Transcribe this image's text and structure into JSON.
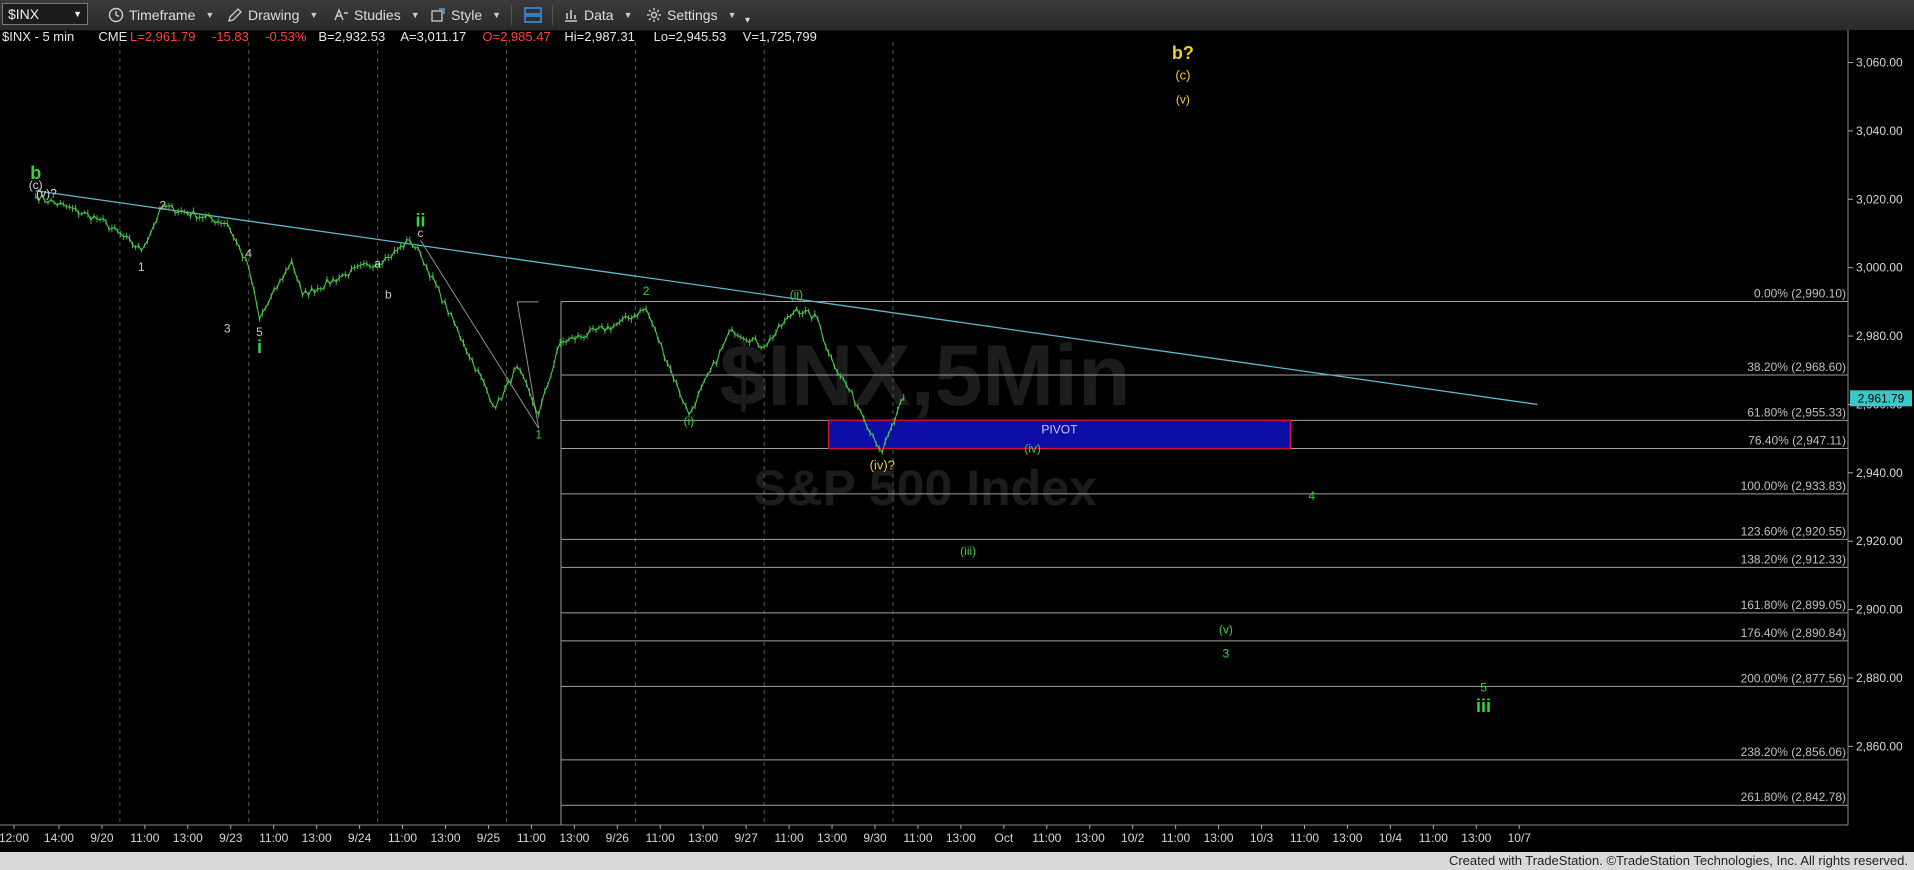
{
  "toolbar": {
    "symbol": "$INX",
    "items": [
      {
        "label": "Timeframe",
        "icon": "clock-icon"
      },
      {
        "label": "Drawing",
        "icon": "pencil-icon"
      },
      {
        "label": "Studies",
        "icon": "studies-icon"
      },
      {
        "label": "Style",
        "icon": "style-icon"
      },
      {
        "label": "",
        "icon": "layout-icon"
      },
      {
        "label": "Data",
        "icon": "bar-chart-icon"
      },
      {
        "label": "Settings",
        "icon": "gear-icon"
      }
    ]
  },
  "quote": [
    {
      "text": "$INX - 5 min",
      "color": "#e8e8e8"
    },
    {
      "text": "CME",
      "color": "#e8e8e8"
    },
    {
      "text": "L=2,961.79",
      "color": "#ff4040"
    },
    {
      "text": "-15.83",
      "color": "#ff4040"
    },
    {
      "text": "-0.53%",
      "color": "#ff4040"
    },
    {
      "text": "B=2,932.53",
      "color": "#e8e8e8"
    },
    {
      "text": "A=3,011.17",
      "color": "#e8e8e8"
    },
    {
      "text": "O=2,985.47",
      "color": "#ff4040"
    },
    {
      "text": "Hi=2,987.31",
      "color": "#e8e8e8"
    },
    {
      "text": "Lo=2,945.53",
      "color": "#e8e8e8"
    },
    {
      "text": "V=1,725,799",
      "color": "#e8e8e8"
    }
  ],
  "watermark": {
    "symbol": "$INX,5Min",
    "name": "S&P 500 Index"
  },
  "footer": {
    "credit": "Created with TradeStation. ©TradeStation Technologies, Inc. All rights reserved."
  },
  "chart_data": {
    "type": "line",
    "series": [
      {
        "x": [
          "9/19 12:00",
          "9/19 15:00",
          "9/20 10:30",
          "9/20 11:30",
          "9/20 14:30",
          "9/20 15:30",
          "9/23 10:00",
          "9/23 11:30",
          "9/23 12:00",
          "9/23 14:00",
          "9/24 10:00",
          "9/24 11:00",
          "9/24 11:30",
          "9/24 13:30",
          "9/24 15:00",
          "9/25 10:00",
          "9/25 11:00",
          "9/25 12:00",
          "9/25 14:30",
          "9/26 10:00",
          "9/26 12:00",
          "9/26 14:00",
          "9/26 15:30",
          "9/27 11:00",
          "9/27 12:00",
          "9/27 12:30",
          "9/27 14:00",
          "9/27 15:00",
          "9/27 16:00"
        ],
        "y": [
          3021,
          3014,
          3005,
          3018,
          3013,
          3000,
          2985,
          3002,
          2992,
          2998,
          3003,
          3008,
          3004,
          2978,
          2959,
          2971,
          2957,
          2978,
          2983,
          2988,
          2957,
          2982,
          2977,
          2988,
          2985,
          2975,
          2958,
          2946,
          2962
        ]
      }
    ],
    "ylim": [
      2837,
      3066
    ],
    "y_ticks": [
      "3,060.00",
      "3,040.00",
      "3,020.00",
      "3,000.00",
      "2,980.00",
      "2,960.00",
      "2,940.00",
      "2,920.00",
      "2,900.00",
      "2,880.00",
      "2,860.00"
    ],
    "y_tick_values": [
      3060,
      3040,
      3020,
      3000,
      2980,
      2960,
      2940,
      2920,
      2900,
      2880,
      2860
    ],
    "x_ticks": [
      "12:00",
      "14:00",
      "9/20",
      "11:00",
      "13:00",
      "9/23",
      "11:00",
      "13:00",
      "9/24",
      "11:00",
      "13:00",
      "9/25",
      "11:00",
      "13:00",
      "9/26",
      "11:00",
      "13:00",
      "9/27",
      "11:00",
      "13:00",
      "9/30",
      "11:00",
      "13:00",
      "Oct",
      "11:00",
      "13:00",
      "10/2",
      "11:00",
      "13:00",
      "10/3",
      "11:00",
      "13:00",
      "10/4",
      "11:00",
      "13:00",
      "10/7"
    ],
    "last_price": {
      "value": 2961.79,
      "label": "2,961.79",
      "color": "#3cc8c8"
    },
    "fib_levels": [
      {
        "label": "0.00% (2,990.10)",
        "value": 2990.1
      },
      {
        "label": "38.20% (2,968.60)",
        "value": 2968.6
      },
      {
        "label": "61.80% (2,955.33)",
        "value": 2955.33
      },
      {
        "label": "76.40% (2,947.11)",
        "value": 2947.11
      },
      {
        "label": "100.00% (2,933.83)",
        "value": 2933.83
      },
      {
        "label": "123.60% (2,920.55)",
        "value": 2920.55
      },
      {
        "label": "138.20% (2,912.33)",
        "value": 2912.33
      },
      {
        "label": "161.80% (2,899.05)",
        "value": 2899.05
      },
      {
        "label": "176.40% (2,890.84)",
        "value": 2890.84
      },
      {
        "label": "200.00% (2,877.56)",
        "value": 2877.56
      },
      {
        "label": "238.20% (2,856.06)",
        "value": 2856.06
      },
      {
        "label": "261.80% (2,842.78)",
        "value": 2842.78
      }
    ],
    "pivot": {
      "label": "PIVOT",
      "from": "9/27 12:30",
      "to": "10/3 10:00",
      "high": 2955.33,
      "low": 2947.11
    },
    "wave_labels": [
      {
        "text": "b",
        "x": "9/19 12:00",
        "y": 3026,
        "color": "#35d435",
        "size": "large"
      },
      {
        "text": "(c)",
        "x": "9/19 12:00",
        "y": 3023,
        "color": "#d8d8d8",
        "size": "small"
      },
      {
        "text": "(v)?",
        "x": "9/19 12:30",
        "y": 3020.5,
        "color": "#d8d8d8",
        "size": "small"
      },
      {
        "text": "1",
        "x": "9/20 10:30",
        "y": 2999,
        "color": "#c8c8c8",
        "size": "small"
      },
      {
        "text": "2",
        "x": "9/20 11:30",
        "y": 3017,
        "color": "#c8c8c8",
        "size": "small"
      },
      {
        "text": "3",
        "x": "9/20 14:30",
        "y": 2981,
        "color": "#c8c8c8",
        "size": "small"
      },
      {
        "text": "4",
        "x": "9/20 15:30",
        "y": 3003,
        "color": "#c8c8c8",
        "size": "small"
      },
      {
        "text": "5",
        "x": "9/23 10:00",
        "y": 2980,
        "color": "#c8c8c8",
        "size": "small"
      },
      {
        "text": "i",
        "x": "9/23 10:00",
        "y": 2975,
        "color": "#35d435",
        "size": "large"
      },
      {
        "text": "a",
        "x": "9/23 15:30",
        "y": 3000,
        "color": "#c8c8c8",
        "size": "small"
      },
      {
        "text": "b",
        "x": "9/24 10:00",
        "y": 2991,
        "color": "#c8c8c8",
        "size": "small"
      },
      {
        "text": "c",
        "x": "9/24 11:30",
        "y": 3009,
        "color": "#c8c8c8",
        "size": "small"
      },
      {
        "text": "ii",
        "x": "9/24 11:30",
        "y": 3012,
        "color": "#35d435",
        "size": "large"
      },
      {
        "text": "1",
        "x": "9/25 11:00",
        "y": 2950,
        "color": "#35d435",
        "size": "small"
      },
      {
        "text": "2",
        "x": "9/26 10:00",
        "y": 2992,
        "color": "#35d435",
        "size": "small"
      },
      {
        "text": "(i)",
        "x": "9/26 12:00",
        "y": 2954,
        "color": "#35d435",
        "size": "small"
      },
      {
        "text": "(ii)",
        "x": "9/27 11:00",
        "y": 2991,
        "color": "#35d435",
        "size": "small"
      },
      {
        "text": "(iv)?",
        "x": "9/27 15:00",
        "y": 2941,
        "color": "#f0d020",
        "size": "medium"
      },
      {
        "text": "b?",
        "x": "10/2 11:00",
        "y": 3061,
        "color": "#f0d020",
        "size": "large"
      },
      {
        "text": "(c)",
        "x": "10/2 11:00",
        "y": 3055,
        "color": "#f0d020",
        "size": "medium"
      },
      {
        "text": "(v)",
        "x": "10/2 11:00",
        "y": 3048,
        "color": "#f0d020",
        "size": "small"
      },
      {
        "text": "(iv)",
        "x": "Oct 10:00",
        "y": 2946,
        "color": "#35d435",
        "size": "small"
      },
      {
        "text": "(iii)",
        "x": "9/30 13:00",
        "y": 2916,
        "color": "#35d435",
        "size": "small"
      },
      {
        "text": "4",
        "x": "10/3 11:00",
        "y": 2932,
        "color": "#35d435",
        "size": "small"
      },
      {
        "text": "(v)",
        "x": "10/2 13:00",
        "y": 2893,
        "color": "#35d435",
        "size": "small"
      },
      {
        "text": "3",
        "x": "10/2 13:00",
        "y": 2886,
        "color": "#35d435",
        "size": "small"
      },
      {
        "text": "5",
        "x": "10/4 13:00",
        "y": 2876,
        "color": "#35d435",
        "size": "small"
      },
      {
        "text": "iii",
        "x": "10/4 13:00",
        "y": 2870,
        "color": "#35d435",
        "size": "large"
      }
    ],
    "grid": false,
    "trendline": {
      "from": {
        "x": "9/19 12:00",
        "y": 3022.5
      },
      "to": {
        "x": "10/7",
        "y": 2960
      },
      "color": "#5fb8c8"
    }
  }
}
